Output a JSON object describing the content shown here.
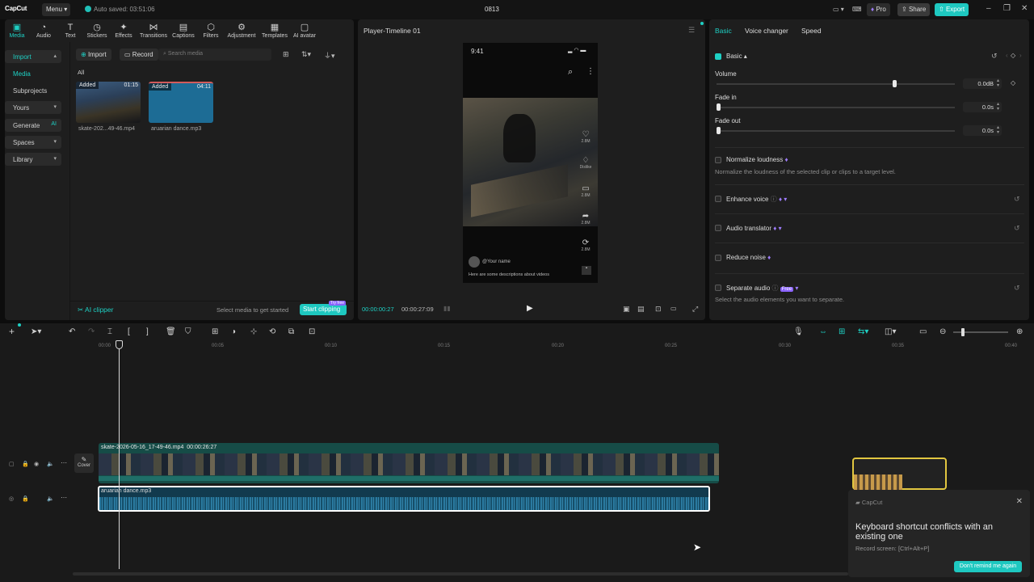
{
  "app": {
    "logo": "CapCut",
    "menu_label": "Menu",
    "autosave": "Auto saved: 03:51:06",
    "project_title": "0813"
  },
  "topbar": {
    "pro_label": "Pro",
    "share_label": "Share",
    "export_label": "Export"
  },
  "tool_tabs": [
    {
      "label": "Media",
      "icon": "media-icon"
    },
    {
      "label": "Audio",
      "icon": "audio-icon"
    },
    {
      "label": "Text",
      "icon": "text-icon"
    },
    {
      "label": "Stickers",
      "icon": "stickers-icon"
    },
    {
      "label": "Effects",
      "icon": "effects-icon"
    },
    {
      "label": "Transitions",
      "icon": "transitions-icon"
    },
    {
      "label": "Captions",
      "icon": "captions-icon"
    },
    {
      "label": "Filters",
      "icon": "filters-icon"
    },
    {
      "label": "Adjustment",
      "icon": "adjustment-icon"
    },
    {
      "label": "Templates",
      "icon": "templates-icon"
    },
    {
      "label": "AI avatar",
      "icon": "ai-avatar-icon"
    }
  ],
  "sidebar": {
    "items": [
      {
        "label": "Import"
      },
      {
        "label": "Media"
      },
      {
        "label": "Subprojects"
      },
      {
        "label": "Yours"
      },
      {
        "label": "Generate"
      },
      {
        "label": "Spaces"
      },
      {
        "label": "Library"
      }
    ],
    "ai_badge": "AI"
  },
  "media": {
    "import_label": "Import",
    "record_label": "Record",
    "search_placeholder": "Search media",
    "filter_all": "All",
    "items": [
      {
        "tag": "Added",
        "duration": "01:15",
        "name": "skate-202...49-46.mp4"
      },
      {
        "tag": "Added",
        "duration": "04:11",
        "name": "aruarian dance.mp3"
      }
    ],
    "ai_clipper": "AI clipper",
    "hint": "Select media to get started",
    "start_clipping": "Start clipping",
    "try_free": "Try free"
  },
  "player": {
    "title": "Player-Timeline 01",
    "time_current": "00:00:00:27",
    "time_total": "00:00:27:09",
    "phone": {
      "clock": "9:41",
      "username": "@Your name",
      "description": "Here are some descriptions about videos",
      "like_count": "2.8M",
      "dislike_label": "Dislike",
      "comment_count": "2.8M",
      "share_count": "2.8M",
      "remix_count": "2.8M"
    }
  },
  "props": {
    "tabs": [
      "Basic",
      "Voice changer",
      "Speed"
    ],
    "section": "Basic",
    "volume": {
      "label": "Volume",
      "value": "0.0dB",
      "level": 0.74
    },
    "fade_in": {
      "label": "Fade in",
      "value": "0.0s",
      "level": 0
    },
    "fade_out": {
      "label": "Fade out",
      "value": "0.0s",
      "level": 0
    },
    "normalize": {
      "label": "Normalize loudness",
      "desc": "Normalize the loudness of the selected clip or clips to a target level."
    },
    "enhance": {
      "label": "Enhance voice"
    },
    "translator": {
      "label": "Audio translator"
    },
    "noise": {
      "label": "Reduce noise"
    },
    "separate": {
      "label": "Separate audio",
      "badge": "Free",
      "desc": "Select the audio elements you want to separate."
    }
  },
  "timeline": {
    "ticks": [
      "00:00",
      "00:05",
      "00:10",
      "00:15",
      "00:20",
      "00:25",
      "00:30",
      "00:35",
      "00:40"
    ],
    "video_clip": {
      "name": "skate-2026-05-16_17-49-46.mp4",
      "duration": "00:00:26:27"
    },
    "audio_clip": {
      "name": "aruarian dance.mp3"
    },
    "cover_label": "Cover"
  },
  "toast": {
    "app": "CapCut",
    "title": "Keyboard shortcut conflicts with an existing one",
    "detail": "Record screen: [Ctrl+Alt+P]",
    "button": "Don't remind me again"
  },
  "colors": {
    "accent": "#1ed0c4",
    "video_track": "#164c47",
    "audio_track": "#123a4e"
  }
}
